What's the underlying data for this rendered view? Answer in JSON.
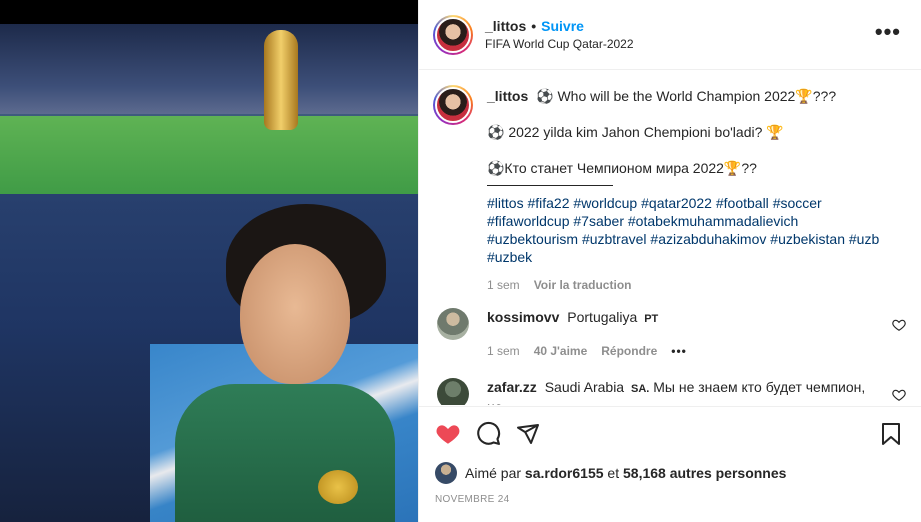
{
  "post": {
    "username": "_littos",
    "dot": "•",
    "follow_label": "Suivre",
    "location": "FIFA World Cup Qatar-2022",
    "more_icon": "•••"
  },
  "caption": {
    "username": "_littos",
    "line1": "⚽ Who will be the World Champion 2022🏆???",
    "line2": "⚽ 2022 yilda kim Jahon Chempioni bo'ladi? 🏆",
    "line3": "⚽Кто станет Чемпионом мира 2022🏆??",
    "hashtags": [
      "#littos",
      "#fifa22",
      "#worldcup",
      "#qatar2022",
      "#football",
      "#soccer",
      "#fifaworldcup",
      "#7saber",
      "#otabekmuhammadalievich",
      "#uzbektourism",
      "#uzbtravel",
      "#azizabduhakimov",
      "#uzbekistan",
      "#uzb",
      "#uzbek"
    ],
    "age": "1 sem",
    "translate_label": "Voir la traduction"
  },
  "comments": [
    {
      "username": "kossimovv",
      "text": "Portugaliya",
      "lang_tag": "PT",
      "age": "1 sem",
      "likes": "40 J'aime",
      "reply_label": "Répondre",
      "more": "•••"
    },
    {
      "username": "zafar.zz",
      "text": "Saudi Arabia",
      "lang_tag": "SA.",
      "text2": "Мы не знаем кто будет чемпион, но"
    }
  ],
  "likes": {
    "prefix": "Aimé par",
    "user": "sa.rdor6155",
    "middle": "et",
    "count": "58,168 autres personnes"
  },
  "date": "NOVEMBRE 24",
  "colors": {
    "like_red": "#ed4956",
    "follow_blue": "#0095f6",
    "hashtag_blue": "#00376b"
  }
}
